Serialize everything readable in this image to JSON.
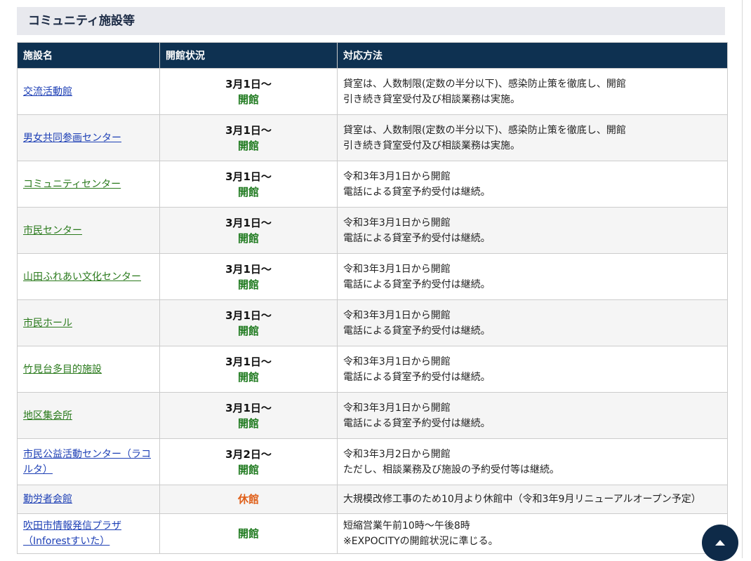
{
  "section": {
    "title": "コミュニティ施設等"
  },
  "table": {
    "headers": {
      "name": "施設名",
      "status": "開館状況",
      "method": "対応方法"
    },
    "rows": [
      {
        "name": "交流活動館",
        "link_color": "blue",
        "date": "3月1日〜",
        "state": "開館",
        "state_type": "open",
        "method": [
          "貸室は、人数制限(定数の半分以下)、感染防止策を徹底し、開館",
          "引き続き貸室受付及び相談業務は実施。"
        ]
      },
      {
        "name": "男女共同参画センター",
        "link_color": "blue",
        "date": "3月1日〜",
        "state": "開館",
        "state_type": "open",
        "method": [
          "貸室は、人数制限(定数の半分以下)、感染防止策を徹底し、開館",
          "引き続き貸室受付及び相談業務は実施。"
        ]
      },
      {
        "name": "コミュニティセンター",
        "link_color": "green",
        "date": "3月1日〜",
        "state": "開館",
        "state_type": "open",
        "method": [
          "令和3年3月1日から開館",
          "電話による貸室予約受付は継続。"
        ]
      },
      {
        "name": "市民センター",
        "link_color": "green",
        "date": "3月1日〜",
        "state": "開館",
        "state_type": "open",
        "method": [
          "令和3年3月1日から開館",
          "電話による貸室予約受付は継続。"
        ]
      },
      {
        "name": "山田ふれあい文化センター",
        "link_color": "green",
        "date": "3月1日〜",
        "state": "開館",
        "state_type": "open",
        "method": [
          "令和3年3月1日から開館",
          "電話による貸室予約受付は継続。"
        ]
      },
      {
        "name": "市民ホール",
        "link_color": "green",
        "date": "3月1日〜",
        "state": "開館",
        "state_type": "open",
        "method": [
          "令和3年3月1日から開館",
          "電話による貸室予約受付は継続。"
        ]
      },
      {
        "name": "竹見台多目的施設",
        "link_color": "green",
        "date": "3月1日〜",
        "state": "開館",
        "state_type": "open",
        "method": [
          "令和3年3月1日から開館",
          "電話による貸室予約受付は継続。"
        ]
      },
      {
        "name": "地区集会所",
        "link_color": "green",
        "date": "3月1日〜",
        "state": "開館",
        "state_type": "open",
        "method": [
          "令和3年3月1日から開館",
          "電話による貸室予約受付は継続。"
        ]
      },
      {
        "name": "市民公益活動センター（ラコルタ）",
        "link_color": "blue",
        "date": "3月2日〜",
        "state": "開館",
        "state_type": "open",
        "method": [
          "令和3年3月2日から開館",
          "ただし、相談業務及び施設の予約受付等は継続。"
        ]
      },
      {
        "name": "勤労者会館",
        "link_color": "blue",
        "date": "",
        "state": "休館",
        "state_type": "closed",
        "method": [
          "大規模改修工事のため10月より休館中（令和3年9月リニューアルオープン予定）"
        ]
      },
      {
        "name": "吹田市情報発信プラザ（Inforestすいた）",
        "link_color": "blue",
        "date": "",
        "state": "開館",
        "state_type": "open",
        "method": [
          "短縮営業午前10時〜午後8時",
          "※EXPOCITYの開館状況に準じる。"
        ]
      }
    ]
  },
  "colors": {
    "header_bg": "#0e3151",
    "open": "#1f7a1f",
    "closed": "#e0601a",
    "link_blue": "#1d3fb5",
    "link_green": "#2a7a1c"
  },
  "back_to_top": {
    "icon": "arrow-up-icon"
  }
}
